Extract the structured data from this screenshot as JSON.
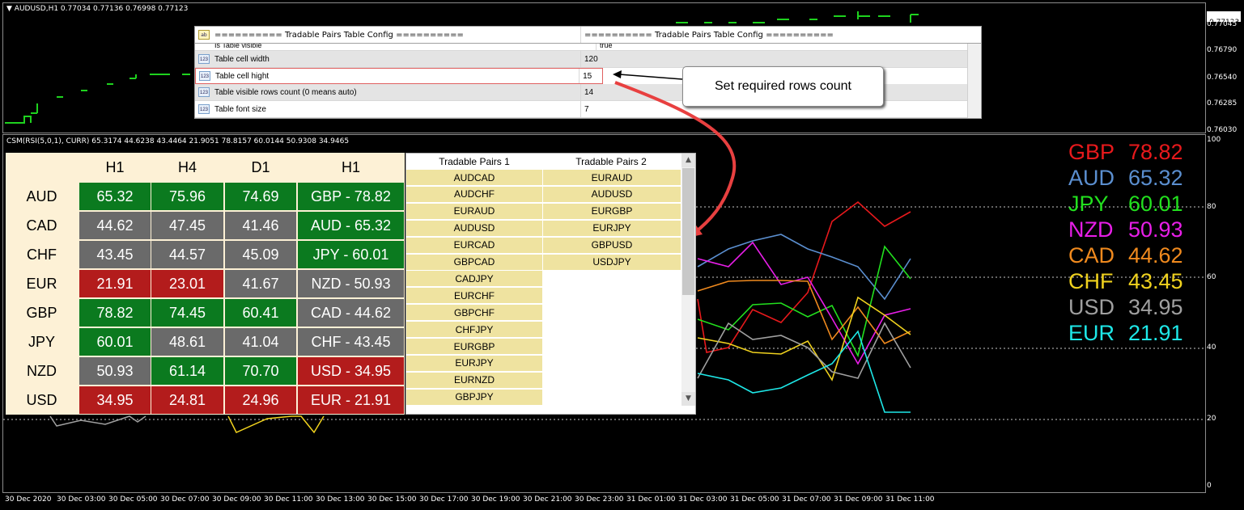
{
  "chart_header": {
    "symbol_line": "AUDUSD,H1  0.77034 0.77136 0.76998 0.77123",
    "indicator_line": "CSM(RSI(5,0,1), CURR) 65.3174 44.6238 43.4464 21.9051 78.8157 60.0144 50.9308 34.9465"
  },
  "price_axis": {
    "current": "0.77123",
    "labels": [
      "0.77045",
      "0.76790",
      "0.76540",
      "0.76285",
      "0.76030"
    ]
  },
  "indicator_axis": {
    "labels": [
      "100",
      "80",
      "60",
      "40",
      "20",
      "0"
    ]
  },
  "time_axis": [
    "30 Dec 2020",
    "30 Dec 03:00",
    "30 Dec 05:00",
    "30 Dec 07:00",
    "30 Dec 09:00",
    "30 Dec 11:00",
    "30 Dec 13:00",
    "30 Dec 15:00",
    "30 Dec 17:00",
    "30 Dec 19:00",
    "30 Dec 21:00",
    "30 Dec 23:00",
    "31 Dec 01:00",
    "31 Dec 03:00",
    "31 Dec 05:00",
    "31 Dec 07:00",
    "31 Dec 09:00",
    "31 Dec 11:00"
  ],
  "config_table": {
    "header_name": "========== Tradable Pairs Table Config ==========",
    "header_value": "========== Tradable Pairs Table Config ==========",
    "partial_row_name": "Is Table visible",
    "partial_row_value": "true",
    "rows": [
      {
        "name": "Table cell width",
        "value": "120"
      },
      {
        "name": "Table cell hight",
        "value": "15"
      },
      {
        "name": "Table visible rows count (0 means auto)",
        "value": "14"
      },
      {
        "name": "Table font size",
        "value": "7"
      }
    ],
    "icon_text": "ab",
    "num_icon_text": "123"
  },
  "callout": {
    "text": "Set required rows count"
  },
  "strength_table": {
    "headers": [
      "H1",
      "H4",
      "D1",
      "H1"
    ],
    "rows": [
      {
        "currency": "AUD",
        "h1": "65.32",
        "h4": "75.96",
        "d1": "74.69",
        "rank": "GBP - 78.82"
      },
      {
        "currency": "CAD",
        "h1": "44.62",
        "h4": "47.45",
        "d1": "41.46",
        "rank": "AUD - 65.32"
      },
      {
        "currency": "CHF",
        "h1": "43.45",
        "h4": "44.57",
        "d1": "45.09",
        "rank": "JPY - 60.01"
      },
      {
        "currency": "EUR",
        "h1": "21.91",
        "h4": "23.01",
        "d1": "41.67",
        "rank": "NZD - 50.93"
      },
      {
        "currency": "GBP",
        "h1": "78.82",
        "h4": "74.45",
        "d1": "60.41",
        "rank": "CAD - 44.62"
      },
      {
        "currency": "JPY",
        "h1": "60.01",
        "h4": "48.61",
        "d1": "41.04",
        "rank": "CHF - 43.45"
      },
      {
        "currency": "NZD",
        "h1": "50.93",
        "h4": "61.14",
        "d1": "70.70",
        "rank": "USD - 34.95"
      },
      {
        "currency": "USD",
        "h1": "34.95",
        "h4": "24.81",
        "d1": "24.96",
        "rank": "EUR - 21.91"
      }
    ],
    "colors": {
      "green": "#0b7a1f",
      "gray": "#6a6a6a",
      "red": "#b31c1c",
      "header_bg": "#fdf1d6"
    }
  },
  "pairs_table": {
    "headers": [
      "Tradable Pairs 1",
      "Tradable Pairs 2"
    ],
    "col1": [
      "AUDCAD",
      "AUDCHF",
      "EURAUD",
      "AUDUSD",
      "EURCAD",
      "GBPCAD",
      "CADJPY",
      "EURCHF",
      "GBPCHF",
      "CHFJPY",
      "EURGBP",
      "EURJPY",
      "EURNZD",
      "GBPJPY"
    ],
    "col2": [
      "EURAUD",
      "AUDUSD",
      "EURGBP",
      "EURJPY",
      "GBPUSD",
      "USDJPY"
    ],
    "cell_color": "#efe3a0"
  },
  "legend": [
    {
      "currency": "GBP",
      "value": "78.82",
      "color": "#e8191c"
    },
    {
      "currency": "AUD",
      "value": "65.32",
      "color": "#5b8fd0"
    },
    {
      "currency": "JPY",
      "value": "60.01",
      "color": "#22e01e"
    },
    {
      "currency": "NZD",
      "value": "50.93",
      "color": "#e81ee8"
    },
    {
      "currency": "CAD",
      "value": "44.62",
      "color": "#f08a1e"
    },
    {
      "currency": "CHF",
      "value": "43.45",
      "color": "#f0d21e"
    },
    {
      "currency": "USD",
      "value": "34.95",
      "color": "#a0a0a0"
    },
    {
      "currency": "EUR",
      "value": "21.91",
      "color": "#1ee8e8"
    }
  ]
}
